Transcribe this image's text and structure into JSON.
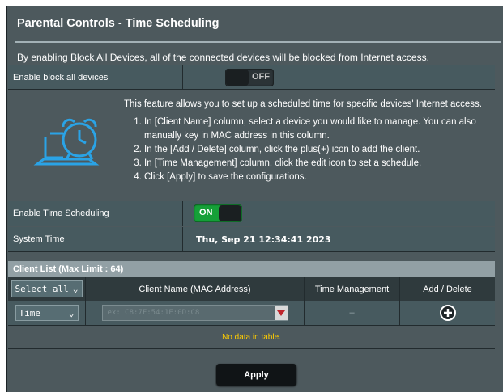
{
  "page": {
    "title": "Parental Controls - Time Scheduling",
    "description": "By enabling Block All Devices, all of the connected devices will be blocked from Internet access."
  },
  "block_all": {
    "label": "Enable block all devices",
    "toggle_state": "OFF"
  },
  "info": {
    "headline": "This feature allows you to set up a scheduled time for specific devices' Internet access.",
    "steps": [
      "In [Client Name] column, select a device you would like to manage. You can also manually key in MAC address in this column.",
      "In the [Add / Delete] column, click the plus(+) icon to add the client.",
      "In [Time Management] column, click the edit icon to set a schedule.",
      "Click [Apply] to save the configurations."
    ],
    "icon": "clock-laptop-icon"
  },
  "time_scheduling": {
    "label": "Enable Time Scheduling",
    "toggle_state": "ON"
  },
  "system_time": {
    "label": "System Time",
    "value": "Thu, Sep 21 12:34:41 2023"
  },
  "client_list": {
    "header": "Client List (Max Limit : 64)",
    "select_all": "Select all",
    "columns": [
      "Client Name (MAC Address)",
      "Time Management",
      "Add / Delete"
    ],
    "row": {
      "mode": "Time",
      "mac_placeholder": "ex: C8:7F:54:1E:0D:C8",
      "time_management": "–",
      "add_icon": "plus-circle-icon"
    },
    "empty_text": "No data in table."
  },
  "apply_label": "Apply",
  "colors": {
    "panel": "#4d595d",
    "toggle_on": "#15a038",
    "icon_blue": "#2aa3e6",
    "warning_text": "#ffcc00",
    "drop_arrow": "#c0262d"
  }
}
